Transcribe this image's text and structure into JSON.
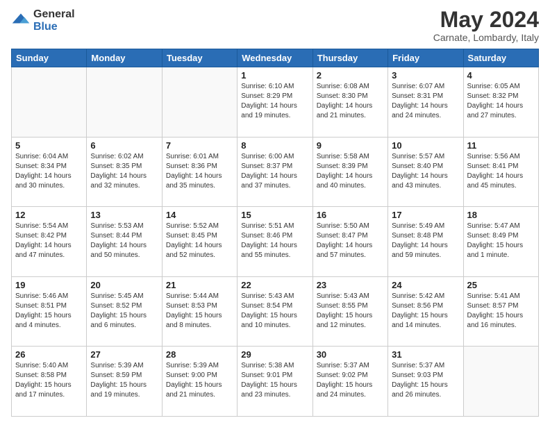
{
  "header": {
    "logo": {
      "general": "General",
      "blue": "Blue"
    },
    "month": "May 2024",
    "location": "Carnate, Lombardy, Italy"
  },
  "weekdays": [
    "Sunday",
    "Monday",
    "Tuesday",
    "Wednesday",
    "Thursday",
    "Friday",
    "Saturday"
  ],
  "weeks": [
    [
      {
        "day": "",
        "empty": true
      },
      {
        "day": "",
        "empty": true
      },
      {
        "day": "",
        "empty": true
      },
      {
        "day": "1",
        "sunrise": "6:10 AM",
        "sunset": "8:29 PM",
        "daylight": "14 hours and 19 minutes."
      },
      {
        "day": "2",
        "sunrise": "6:08 AM",
        "sunset": "8:30 PM",
        "daylight": "14 hours and 21 minutes."
      },
      {
        "day": "3",
        "sunrise": "6:07 AM",
        "sunset": "8:31 PM",
        "daylight": "14 hours and 24 minutes."
      },
      {
        "day": "4",
        "sunrise": "6:05 AM",
        "sunset": "8:32 PM",
        "daylight": "14 hours and 27 minutes."
      }
    ],
    [
      {
        "day": "5",
        "sunrise": "6:04 AM",
        "sunset": "8:34 PM",
        "daylight": "14 hours and 30 minutes."
      },
      {
        "day": "6",
        "sunrise": "6:02 AM",
        "sunset": "8:35 PM",
        "daylight": "14 hours and 32 minutes."
      },
      {
        "day": "7",
        "sunrise": "6:01 AM",
        "sunset": "8:36 PM",
        "daylight": "14 hours and 35 minutes."
      },
      {
        "day": "8",
        "sunrise": "6:00 AM",
        "sunset": "8:37 PM",
        "daylight": "14 hours and 37 minutes."
      },
      {
        "day": "9",
        "sunrise": "5:58 AM",
        "sunset": "8:39 PM",
        "daylight": "14 hours and 40 minutes."
      },
      {
        "day": "10",
        "sunrise": "5:57 AM",
        "sunset": "8:40 PM",
        "daylight": "14 hours and 43 minutes."
      },
      {
        "day": "11",
        "sunrise": "5:56 AM",
        "sunset": "8:41 PM",
        "daylight": "14 hours and 45 minutes."
      }
    ],
    [
      {
        "day": "12",
        "sunrise": "5:54 AM",
        "sunset": "8:42 PM",
        "daylight": "14 hours and 47 minutes."
      },
      {
        "day": "13",
        "sunrise": "5:53 AM",
        "sunset": "8:44 PM",
        "daylight": "14 hours and 50 minutes."
      },
      {
        "day": "14",
        "sunrise": "5:52 AM",
        "sunset": "8:45 PM",
        "daylight": "14 hours and 52 minutes."
      },
      {
        "day": "15",
        "sunrise": "5:51 AM",
        "sunset": "8:46 PM",
        "daylight": "14 hours and 55 minutes."
      },
      {
        "day": "16",
        "sunrise": "5:50 AM",
        "sunset": "8:47 PM",
        "daylight": "14 hours and 57 minutes."
      },
      {
        "day": "17",
        "sunrise": "5:49 AM",
        "sunset": "8:48 PM",
        "daylight": "14 hours and 59 minutes."
      },
      {
        "day": "18",
        "sunrise": "5:47 AM",
        "sunset": "8:49 PM",
        "daylight": "15 hours and 1 minute."
      }
    ],
    [
      {
        "day": "19",
        "sunrise": "5:46 AM",
        "sunset": "8:51 PM",
        "daylight": "15 hours and 4 minutes."
      },
      {
        "day": "20",
        "sunrise": "5:45 AM",
        "sunset": "8:52 PM",
        "daylight": "15 hours and 6 minutes."
      },
      {
        "day": "21",
        "sunrise": "5:44 AM",
        "sunset": "8:53 PM",
        "daylight": "15 hours and 8 minutes."
      },
      {
        "day": "22",
        "sunrise": "5:43 AM",
        "sunset": "8:54 PM",
        "daylight": "15 hours and 10 minutes."
      },
      {
        "day": "23",
        "sunrise": "5:43 AM",
        "sunset": "8:55 PM",
        "daylight": "15 hours and 12 minutes."
      },
      {
        "day": "24",
        "sunrise": "5:42 AM",
        "sunset": "8:56 PM",
        "daylight": "15 hours and 14 minutes."
      },
      {
        "day": "25",
        "sunrise": "5:41 AM",
        "sunset": "8:57 PM",
        "daylight": "15 hours and 16 minutes."
      }
    ],
    [
      {
        "day": "26",
        "sunrise": "5:40 AM",
        "sunset": "8:58 PM",
        "daylight": "15 hours and 17 minutes."
      },
      {
        "day": "27",
        "sunrise": "5:39 AM",
        "sunset": "8:59 PM",
        "daylight": "15 hours and 19 minutes."
      },
      {
        "day": "28",
        "sunrise": "5:39 AM",
        "sunset": "9:00 PM",
        "daylight": "15 hours and 21 minutes."
      },
      {
        "day": "29",
        "sunrise": "5:38 AM",
        "sunset": "9:01 PM",
        "daylight": "15 hours and 23 minutes."
      },
      {
        "day": "30",
        "sunrise": "5:37 AM",
        "sunset": "9:02 PM",
        "daylight": "15 hours and 24 minutes."
      },
      {
        "day": "31",
        "sunrise": "5:37 AM",
        "sunset": "9:03 PM",
        "daylight": "15 hours and 26 minutes."
      },
      {
        "day": "",
        "empty": true
      }
    ]
  ],
  "labels": {
    "sunrise": "Sunrise:",
    "sunset": "Sunset:",
    "daylight": "Daylight:"
  }
}
